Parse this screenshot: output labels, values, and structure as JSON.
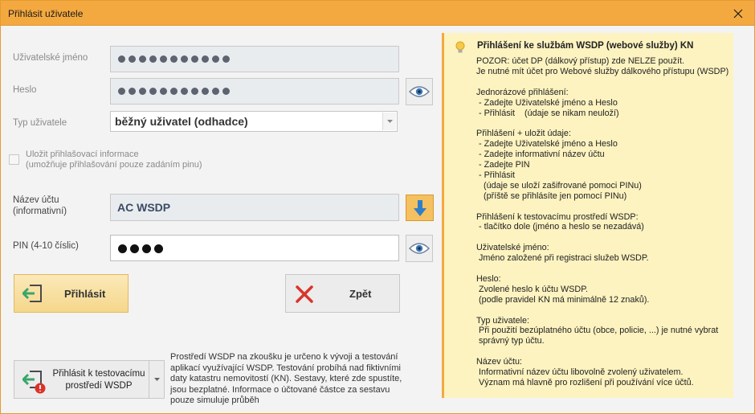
{
  "window": {
    "title": "Přihlásit uživatele"
  },
  "form": {
    "username_label": "Uživatelské jméno",
    "password_label": "Heslo",
    "user_type_label": "Typ uživatele",
    "user_type_value": "běžný uživatel (odhadce)",
    "save_login_label_1": "Uložit přihlašovací informace",
    "save_login_label_2": "(umožňuje přihlašování pouze zadáním pinu)",
    "account_name_label_1": "Název účtu",
    "account_name_label_2": "(informativní)",
    "account_name_value": "AC WSDP",
    "pin_label": "PIN (4-10 číslic)"
  },
  "buttons": {
    "login": "Přihlásit",
    "back": "Zpět",
    "test_login_1": "Přihlásit k testovacímu",
    "test_login_2": "prostředí WSDP"
  },
  "test_note": "Prostředí WSDP na zkoušku je určeno k vývoji a testování aplikací využívající WSDP. Testování probíhá nad fiktivními daty katastru nemovitostí (KN). Sestavy, které zde spustíte, jsou bezplatné. Informace o účtované částce za sestavu pouze simuluje průběh",
  "help": {
    "title": "Přihlášení ke službám WSDP (webové služby) KN",
    "lines": [
      "POZOR: účet DP (dálkový přístup) zde NELZE použít.",
      "Je nutné mít účet pro Webové služby dálkového přístupu (WSDP)",
      "",
      "Jednorázové přihlášení:",
      " - Zadejte Uživatelské jméno a Heslo",
      " - Přihlásit    (údaje se nikam neuloží)",
      "",
      "Přihlášení + uložit údaje:",
      " - Zadejte Uživatelské jméno a Heslo",
      " - Zadejte informativní název účtu",
      " - Zadejte PIN",
      " - Přihlásit",
      "   (údaje se uloží zašifrované pomoci PINu)",
      "   (příště se přihlásíte jen pomocí PINu)",
      "",
      "Přihlášení k testovacímu prostředí WSDP:",
      " - tlačítko dole (jméno a heslo se nezadává)",
      "",
      "Uživatelské jméno:",
      " Jméno založené při registraci služeb WSDP.",
      "",
      "Heslo:",
      " Zvolené heslo k účtu WSDP.",
      " (podle pravidel KN má minimálně 12 znaků).",
      "",
      "Typ uživatele:",
      " Při použití bezúplatného účtu (obce, policie, ...) je nutné vybrat",
      " správný typ účtu.",
      "",
      "Název účtu:",
      " Informativní název účtu libovolně zvolený uživatelem.",
      " Význam má hlavně pro rozlišení při používání více účtů."
    ]
  },
  "icons": {
    "close": "close-icon",
    "eye": "eye-icon",
    "bulb": "lightbulb-icon",
    "arrow_down": "arrow-down-icon",
    "login": "login-arrow-icon",
    "cancel": "red-x-icon",
    "warning": "warning-badge-icon"
  },
  "colors": {
    "title_bar": "#f4a940",
    "help_bg": "#fdf3c0",
    "login_button": "#f5d78c",
    "accent_blue": "#2f7fc8",
    "cancel_red": "#d9342b"
  }
}
